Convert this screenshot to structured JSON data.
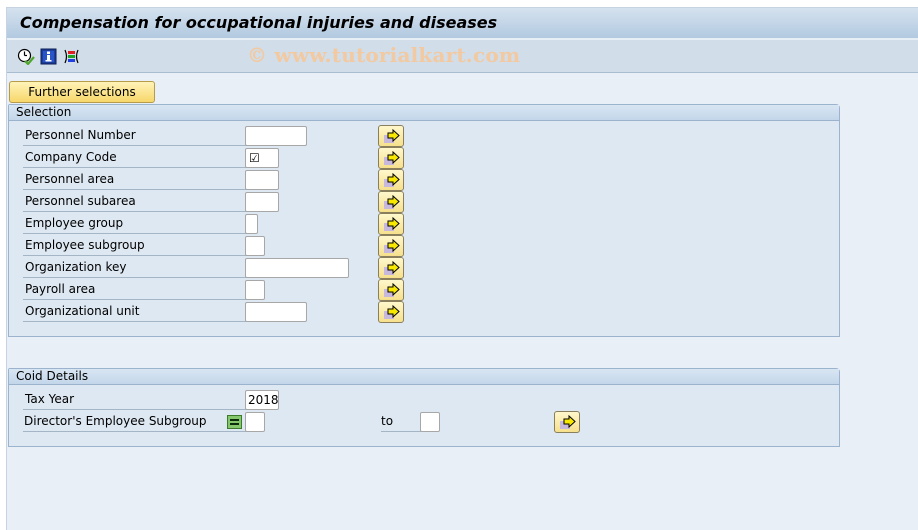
{
  "window": {
    "title": "Compensation for occupational injuries and diseases",
    "watermark": "© www.tutorialkart.com"
  },
  "toolbar": {
    "buttons": [
      {
        "icon": "execute-clock-icon",
        "tooltip": "Execute"
      },
      {
        "icon": "info-icon",
        "tooltip": "Information"
      },
      {
        "icon": "selection-options-icon",
        "tooltip": "Selection options"
      }
    ]
  },
  "further_selections_label": "Further selections",
  "selection": {
    "title": "Selection",
    "rows": [
      {
        "label": "Personnel Number",
        "value": ""
      },
      {
        "label": "Company Code",
        "value": "☑"
      },
      {
        "label": "Personnel area",
        "value": ""
      },
      {
        "label": "Personnel subarea",
        "value": ""
      },
      {
        "label": "Employee group",
        "value": ""
      },
      {
        "label": "Employee subgroup",
        "value": ""
      },
      {
        "label": "Organization key",
        "value": ""
      },
      {
        "label": "Payroll area",
        "value": ""
      },
      {
        "label": "Organizational unit",
        "value": ""
      }
    ]
  },
  "coid": {
    "title": "Coid Details",
    "tax_year_label": "Tax Year",
    "tax_year_value": "2018",
    "director_label": "Director's Employee Subgroup",
    "director_from": "",
    "to_label": "to",
    "director_to": ""
  },
  "colors": {
    "button_yellow": "#f7d76b",
    "background": "#e9eff7",
    "group_bg": "#dee8f2"
  }
}
